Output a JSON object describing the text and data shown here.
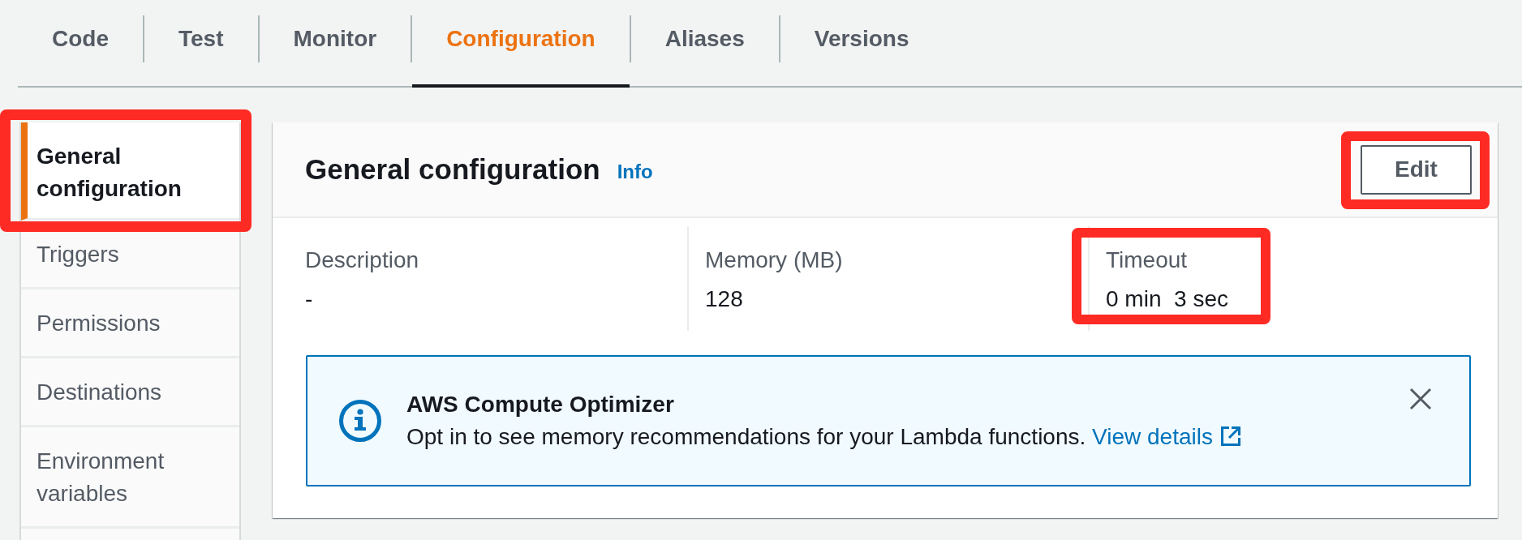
{
  "tabs": [
    {
      "label": "Code",
      "selected": false
    },
    {
      "label": "Test",
      "selected": false
    },
    {
      "label": "Monitor",
      "selected": false
    },
    {
      "label": "Configuration",
      "selected": true
    },
    {
      "label": "Aliases",
      "selected": false
    },
    {
      "label": "Versions",
      "selected": false
    }
  ],
  "sidebar": {
    "items": [
      {
        "label": "General configuration",
        "selected": true,
        "highlighted": true
      },
      {
        "label": "Triggers",
        "selected": false,
        "highlighted": false
      },
      {
        "label": "Permissions",
        "selected": false,
        "highlighted": false
      },
      {
        "label": "Destinations",
        "selected": false,
        "highlighted": false
      },
      {
        "label": "Environment variables",
        "selected": false,
        "highlighted": false
      }
    ]
  },
  "panel": {
    "title": "General configuration",
    "info_link": "Info",
    "edit_button": {
      "label": "Edit",
      "highlighted": true
    },
    "fields": [
      {
        "label": "Description",
        "value": "-",
        "highlighted": false
      },
      {
        "label": "Memory (MB)",
        "value": "128",
        "highlighted": false
      },
      {
        "label": "Timeout",
        "value": "0 min  3 sec",
        "highlighted": true
      }
    ],
    "alert": {
      "title": "AWS Compute Optimizer",
      "message": "Opt in to see memory recommendations for your Lambda functions.",
      "link": "View details",
      "dismissible": true
    }
  }
}
